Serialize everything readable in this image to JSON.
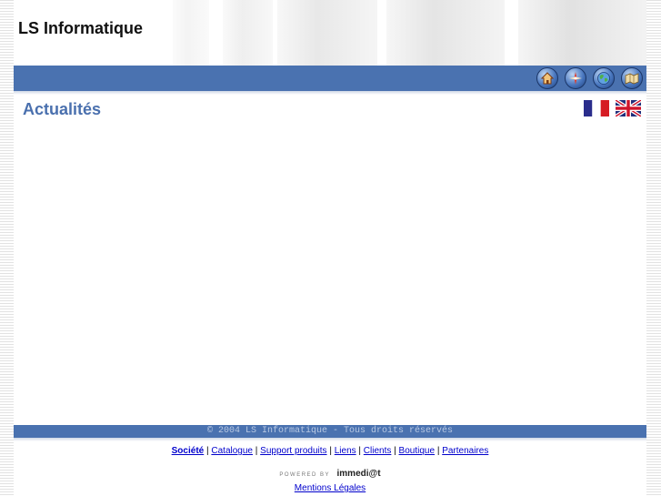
{
  "header": {
    "site_title": "LS Informatique"
  },
  "nav_icons": [
    {
      "name": "home-icon"
    },
    {
      "name": "compass-icon"
    },
    {
      "name": "globe-icon"
    },
    {
      "name": "map-icon"
    }
  ],
  "page": {
    "title": "Actualités"
  },
  "languages": [
    {
      "name": "french-flag"
    },
    {
      "name": "english-flag"
    }
  ],
  "footer": {
    "copyright": "© 2004 LS Informatique - Tous droits réservés",
    "links": [
      "Société",
      "Catalogue",
      "Support produits",
      "Liens",
      "Clients",
      "Boutique",
      "Partenaires"
    ],
    "separator": "|",
    "powered_by": "POWERED BY",
    "powered_brand": "immedi@t",
    "legal": "Mentions Légales"
  },
  "colors": {
    "bar": "#4a72b0",
    "title": "#4a70ae",
    "link": "#0000cc"
  }
}
